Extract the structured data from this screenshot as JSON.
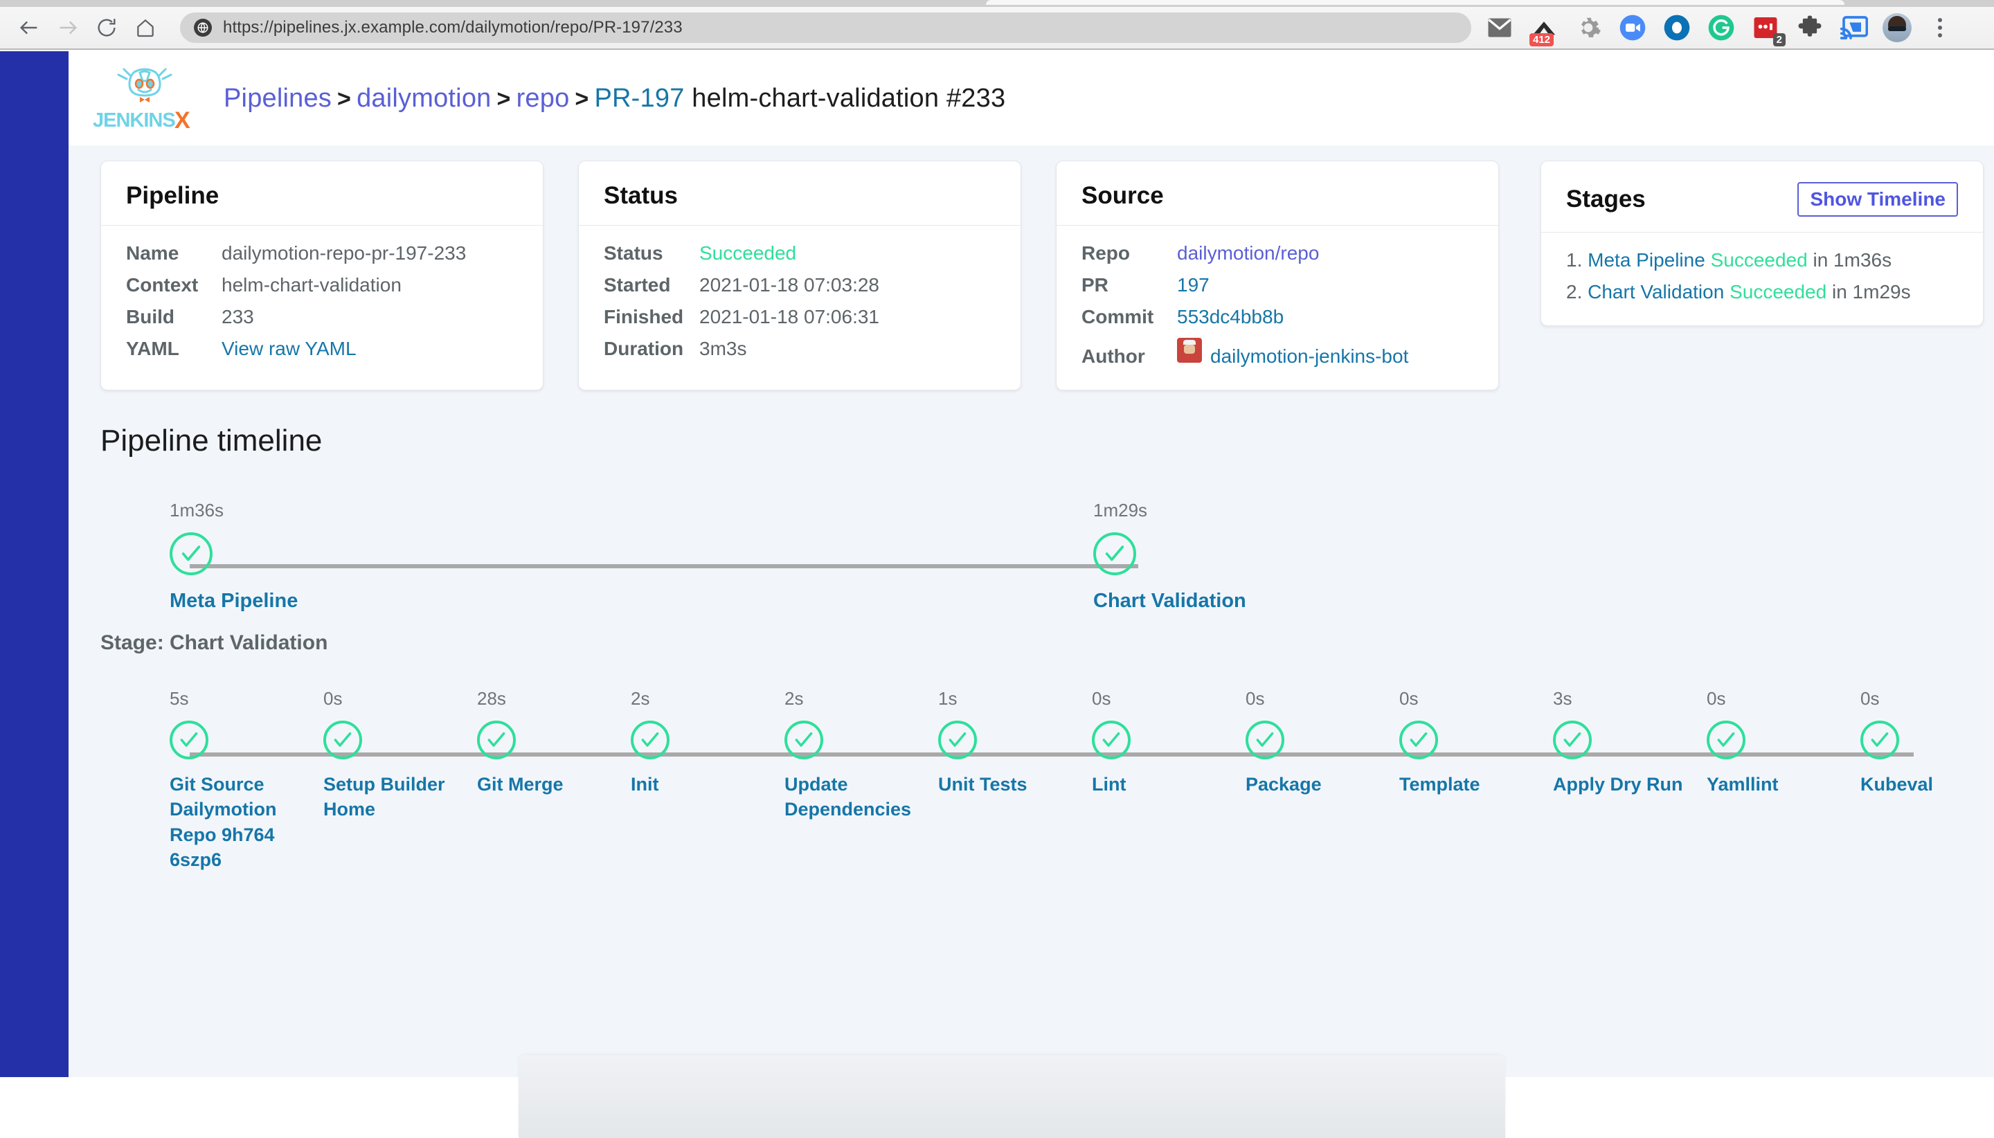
{
  "browser": {
    "url": "https://pipelines.jx.example.com/dailymotion/repo/PR-197/233",
    "back_label": "Back",
    "forward_label": "Forward",
    "reload_label": "Reload",
    "home_label": "Home",
    "extensions": [
      {
        "name": "mail-icon",
        "badge": ""
      },
      {
        "name": "upload-arrow-icon",
        "badge": "412"
      },
      {
        "name": "gear-icon",
        "badge": ""
      },
      {
        "name": "video-call-icon",
        "badge": ""
      },
      {
        "name": "circle-o-icon",
        "badge": ""
      },
      {
        "name": "grammarly-icon",
        "badge": ""
      },
      {
        "name": "red-card-icon",
        "badge": "2"
      },
      {
        "name": "puzzle-icon",
        "badge": ""
      },
      {
        "name": "cast-icon",
        "badge": ""
      }
    ],
    "profile_label": "Profile",
    "menu_label": "Customize and control"
  },
  "app": {
    "logo_text": "JENKINS",
    "logo_x": "X"
  },
  "breadcrumb": {
    "pipelines": "Pipelines",
    "org": "dailymotion",
    "repo": "repo",
    "pr": "PR-197",
    "context": "helm-chart-validation",
    "build": "#233",
    "separator": ">"
  },
  "cards": {
    "pipeline": {
      "title": "Pipeline",
      "rows": [
        {
          "key": "Name",
          "value": "dailymotion-repo-pr-197-233",
          "style": "plain"
        },
        {
          "key": "Context",
          "value": "helm-chart-validation",
          "style": "plain"
        },
        {
          "key": "Build",
          "value": "233",
          "style": "plain"
        },
        {
          "key": "YAML",
          "value": "View raw YAML",
          "style": "link"
        }
      ]
    },
    "status": {
      "title": "Status",
      "rows": [
        {
          "key": "Status",
          "value": "Succeeded",
          "style": "ok"
        },
        {
          "key": "Started",
          "value": "2021-01-18 07:03:28",
          "style": "plain"
        },
        {
          "key": "Finished",
          "value": "2021-01-18 07:06:31",
          "style": "plain"
        },
        {
          "key": "Duration",
          "value": "3m3s",
          "style": "plain"
        }
      ]
    },
    "source": {
      "title": "Source",
      "rows": [
        {
          "key": "Repo",
          "value": "dailymotion/repo",
          "style": "link-purple"
        },
        {
          "key": "PR",
          "value": "197",
          "style": "link"
        },
        {
          "key": "Commit",
          "value": "553dc4bb8b",
          "style": "link"
        },
        {
          "key": "Author",
          "value": "dailymotion-jenkins-bot",
          "style": "link"
        }
      ]
    },
    "stages": {
      "title": "Stages",
      "show_timeline_label": "Show Timeline",
      "items": [
        {
          "index": "1.",
          "name": "Meta Pipeline",
          "status": "Succeeded",
          "in": "in",
          "duration": "1m36s"
        },
        {
          "index": "2.",
          "name": "Chart Validation",
          "status": "Succeeded",
          "in": "in",
          "duration": "1m29s"
        }
      ]
    }
  },
  "timeline": {
    "title": "Pipeline timeline",
    "stages": [
      {
        "duration": "1m36s",
        "label": "Meta Pipeline"
      },
      {
        "duration": "1m29s",
        "label": "Chart Validation"
      }
    ],
    "stage_heading": "Stage: Chart Validation",
    "steps": [
      {
        "duration": "5s",
        "label": "Git Source Dailymotion Repo 9h764 6szp6"
      },
      {
        "duration": "0s",
        "label": "Setup Builder Home"
      },
      {
        "duration": "28s",
        "label": "Git Merge"
      },
      {
        "duration": "2s",
        "label": "Init"
      },
      {
        "duration": "2s",
        "label": "Update Dependencies"
      },
      {
        "duration": "1s",
        "label": "Unit Tests"
      },
      {
        "duration": "0s",
        "label": "Lint"
      },
      {
        "duration": "0s",
        "label": "Package"
      },
      {
        "duration": "0s",
        "label": "Template"
      },
      {
        "duration": "3s",
        "label": "Apply Dry Run"
      },
      {
        "duration": "0s",
        "label": "Yamllint"
      },
      {
        "duration": "0s",
        "label": "Kubeval"
      }
    ]
  },
  "colors": {
    "sidebar": "#2430a8",
    "success": "#2fdf9a",
    "link_blue": "#1676a8",
    "link_purple": "#5a5fd6",
    "page_bg": "#f2f6fb"
  }
}
